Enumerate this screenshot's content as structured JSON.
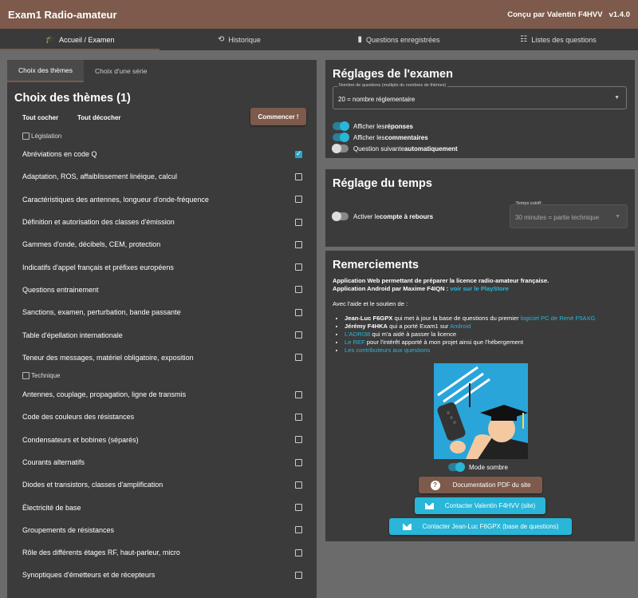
{
  "header": {
    "title": "Exam1 Radio-amateur",
    "author": "Conçu par Valentin F4HVV",
    "version": "v1.4.0"
  },
  "nav": [
    {
      "label": "Accueil / Examen",
      "icon": "graduation-cap-icon"
    },
    {
      "label": "Historique",
      "icon": "history-icon"
    },
    {
      "label": "Questions enregistrées",
      "icon": "bookmark-icon"
    },
    {
      "label": "Listes des questions",
      "icon": "list-icon"
    }
  ],
  "left": {
    "tabs": [
      "Choix des thèmes",
      "Choix d'une série"
    ],
    "title": "Choix des thèmes (1)",
    "check_all": "Tout cocher",
    "uncheck_all": "Tout décocher",
    "start": "Commencer !",
    "cat1": "Législation",
    "cat2": "Technique",
    "themes1": [
      {
        "label": "Abréviations en code Q",
        "checked": true
      },
      {
        "label": "Adaptation, ROS, affaiblissement linéique, calcul",
        "checked": false
      },
      {
        "label": "Caractéristiques des antennes, longueur d'onde-fréquence",
        "checked": false
      },
      {
        "label": "Définition et autorisation des classes d'émission",
        "checked": false
      },
      {
        "label": "Gammes d'onde, décibels, CEM, protection",
        "checked": false
      },
      {
        "label": "Indicatifs d'appel français et préfixes européens",
        "checked": false
      },
      {
        "label": "Questions entrainement",
        "checked": false
      },
      {
        "label": "Sanctions, examen, perturbation, bande passante",
        "checked": false
      },
      {
        "label": "Table d'épellation internationale",
        "checked": false
      },
      {
        "label": "Teneur des messages, matériel obligatoire, exposition",
        "checked": false
      }
    ],
    "themes2": [
      {
        "label": "Antennes, couplage, propagation, ligne de transmis",
        "checked": false
      },
      {
        "label": "Code des couleurs des résistances",
        "checked": false
      },
      {
        "label": "Condensateurs et bobines (séparés)",
        "checked": false
      },
      {
        "label": "Courants alternatifs",
        "checked": false
      },
      {
        "label": "Diodes et transistors, classes d'amplification",
        "checked": false
      },
      {
        "label": "Électricité de base",
        "checked": false
      },
      {
        "label": "Groupements de résistances",
        "checked": false
      },
      {
        "label": "Rôle des différents étages RF, haut-parleur, micro",
        "checked": false
      },
      {
        "label": "Synoptiques d'émetteurs et de récepteurs",
        "checked": false
      }
    ]
  },
  "settings": {
    "title": "Réglages de l'examen",
    "select_legend": "Nombre de questions (multiple du nombres de thèmes)",
    "select_value": "20 = nombre réglementaire",
    "t1_pre": "Afficher les ",
    "t1_b": "réponses",
    "t2_pre": "Afficher les ",
    "t2_b": "commentaires",
    "t3_pre": "Question suivante ",
    "t3_b": "automatiquement"
  },
  "timer": {
    "title": "Réglage du temps",
    "toggle_pre": "Activer le ",
    "toggle_b": "compte à rebours",
    "legend": "Temps cutoff",
    "value": "30 minutes = partie technique"
  },
  "thanks": {
    "title": "Remerciements",
    "line1": "Application Web permettant de préparer la licence radio-amateur française.",
    "line2": "Application Android par Maxime F4IQN :",
    "line2_link": "voir sur le PlayStore",
    "intro": "Avec l'aide et le soutien de :",
    "i1_b": "Jean-Luc F6GPX",
    "i1_t": " qui met à jour la base de questions du premier ",
    "i1_l": "logiciel PC de René F5AXG",
    "i2_b": "Jérémy F4HKA",
    "i2_t": " qui a porté Exam1 sur ",
    "i2_l": "Android",
    "i3_l": "L'ADRI38",
    "i3_t": " qui m'a aidé à passer la licence",
    "i4_l": "Le REF",
    "i4_t": " pour l'intérêt apporté à mon projet ainsi que l'hébergement",
    "i5_l": "Les contributeurs aux questions",
    "dark_mode": "Mode sombre",
    "doc_btn": "Documentation PDF du site",
    "contact1": "Contacter Valentin F4HVV (site)",
    "contact2": "Contacter Jean-Luc F6GPX (base de questions)"
  }
}
